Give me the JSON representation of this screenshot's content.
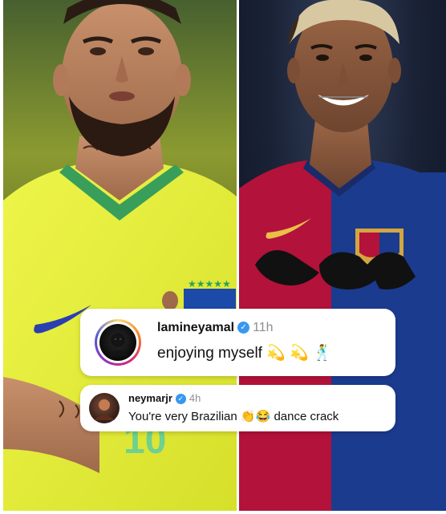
{
  "post": {
    "comment": {
      "username": "lamineyamal",
      "time": "11h",
      "text": "enjoying myself",
      "emojis": [
        "💫",
        "💫",
        "🕺"
      ]
    },
    "reply": {
      "username": "neymarjr",
      "time": "4h",
      "text": "You're very Brazilian",
      "emojis": [
        "👏",
        "😂"
      ],
      "text_after": "dance crack"
    }
  },
  "colors": {
    "brazil_yellow": "#e8f13a",
    "brazil_collar": "#3a9e5b",
    "barca_red": "#b3123a",
    "barca_blue": "#1b3b8f",
    "verified_blue": "#3897f0"
  },
  "icons": {
    "verified": "verified-badge-icon",
    "nike": "nike-swoosh-icon",
    "cbf_crest": "cbf-crest-icon",
    "fcb_crest": "fcb-crest-icon"
  }
}
